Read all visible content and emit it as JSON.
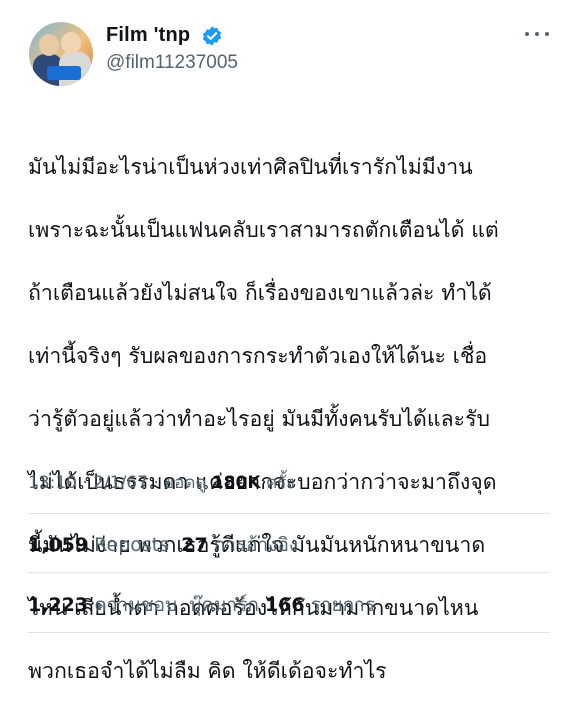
{
  "author": {
    "display_name": "Film 'tnp",
    "handle": "@film11237005",
    "avatar_icon": "avatar-photo",
    "verified_icon": "verified-badge-icon"
  },
  "tweet": {
    "lines": [
      "มันไม่มีอะไรน่าเป็นห่วงเท่าศิลปินที่เรารักไม่มีงาน",
      "เพราะฉะนั้นเป็นแฟนคลับเราสามารถตักเตือนได้ แต่",
      "ถ้าเตือนแล้วยังไม่สนใจ ก็เรื่องของเขาแล้วล่ะ ทำได้",
      "เท่านี้จริงๆ รับผลของการกระทำตัวเองให้ได้นะ เชื่อ",
      "ว่ารู้ตัวอยู่แล้วว่าทำอะไรอยู่ มันมีทั้งคนรับได้และรับ",
      "ไม่ได้เป็นธรรมดา แค่อยากจะบอกว่ากว่าจะมาถึงจุด",
      "นี้มันไม่ง่าย พวกเธอรู้ดีแก่ใจ มันมันหนักหนาขนาด",
      "ไหน เสียน้ำตา กอดคอร้องไห้กันมามากขนาดไหน",
      "พวกเธอจำได้ไม่ลืม คิด ให้ดีเด้อจะทำไร"
    ]
  },
  "meta": {
    "time": "13:10",
    "separator": "·",
    "date": "2/1/67",
    "views_label": "ยอดดู",
    "views_count": "180K",
    "views_unit": "ครั้ง"
  },
  "stats": {
    "reposts_count": "1,059",
    "reposts_label": "Reposts",
    "quotes_count": "27",
    "quotes_label": "การอ้างอิง",
    "likes_count": "1,223",
    "likes_label": "ความชอบ",
    "bookmarks_label": "บุ๊คมาร์ก",
    "bookmarks_count": "166",
    "bookmarks_unit": "รายการ"
  },
  "colors": {
    "text": "#0f1419",
    "secondary": "#536471",
    "verified": "#1d9bf0",
    "divider": "#dfe3e6"
  }
}
